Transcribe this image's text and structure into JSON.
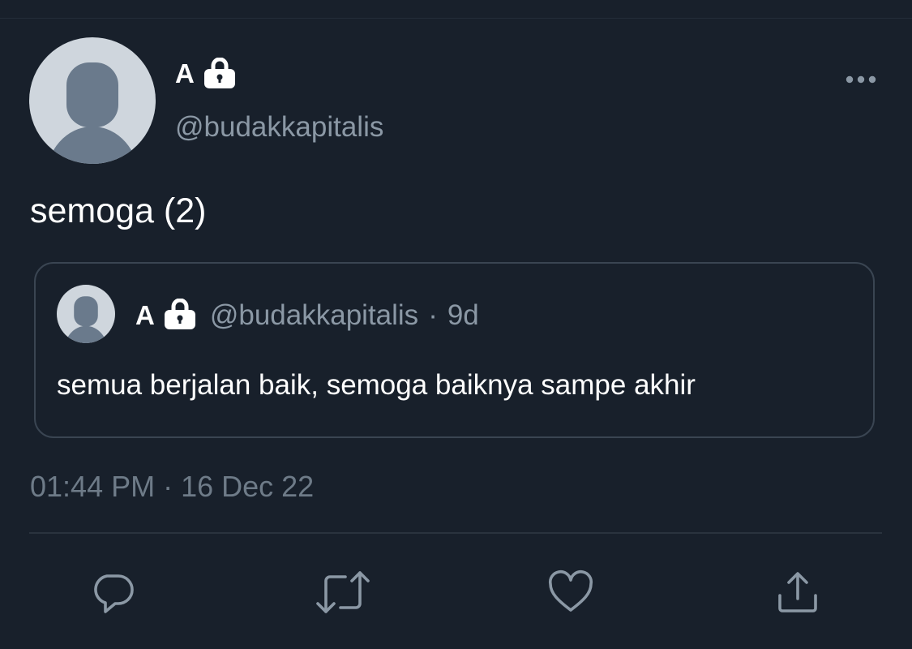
{
  "tweet": {
    "author": {
      "display_name": "A",
      "handle": "@budakkapitalis",
      "protected_icon": "lock-icon",
      "avatar_icon": "default-avatar-icon"
    },
    "menu_icon": "more-horizontal-icon",
    "text": "semoga (2)",
    "quoted_tweet": {
      "author": {
        "display_name": "A",
        "handle": "@budakkapitalis",
        "protected_icon": "lock-icon"
      },
      "separator": "·",
      "time_ago": "9d",
      "text": "semua berjalan baik, semoga baiknya sampe akhir"
    },
    "timestamp": {
      "time": "01:44 PM",
      "separator": "·",
      "date": "16 Dec 22"
    },
    "actions": [
      {
        "name": "reply",
        "icon": "reply-icon"
      },
      {
        "name": "retweet",
        "icon": "retweet-icon"
      },
      {
        "name": "like",
        "icon": "heart-icon"
      },
      {
        "name": "share",
        "icon": "share-icon"
      }
    ]
  },
  "colors": {
    "background": "#18202b",
    "text_primary": "#ffffff",
    "text_secondary": "#8b98a5",
    "border": "#3a4552",
    "icon": "#8b98a5"
  }
}
